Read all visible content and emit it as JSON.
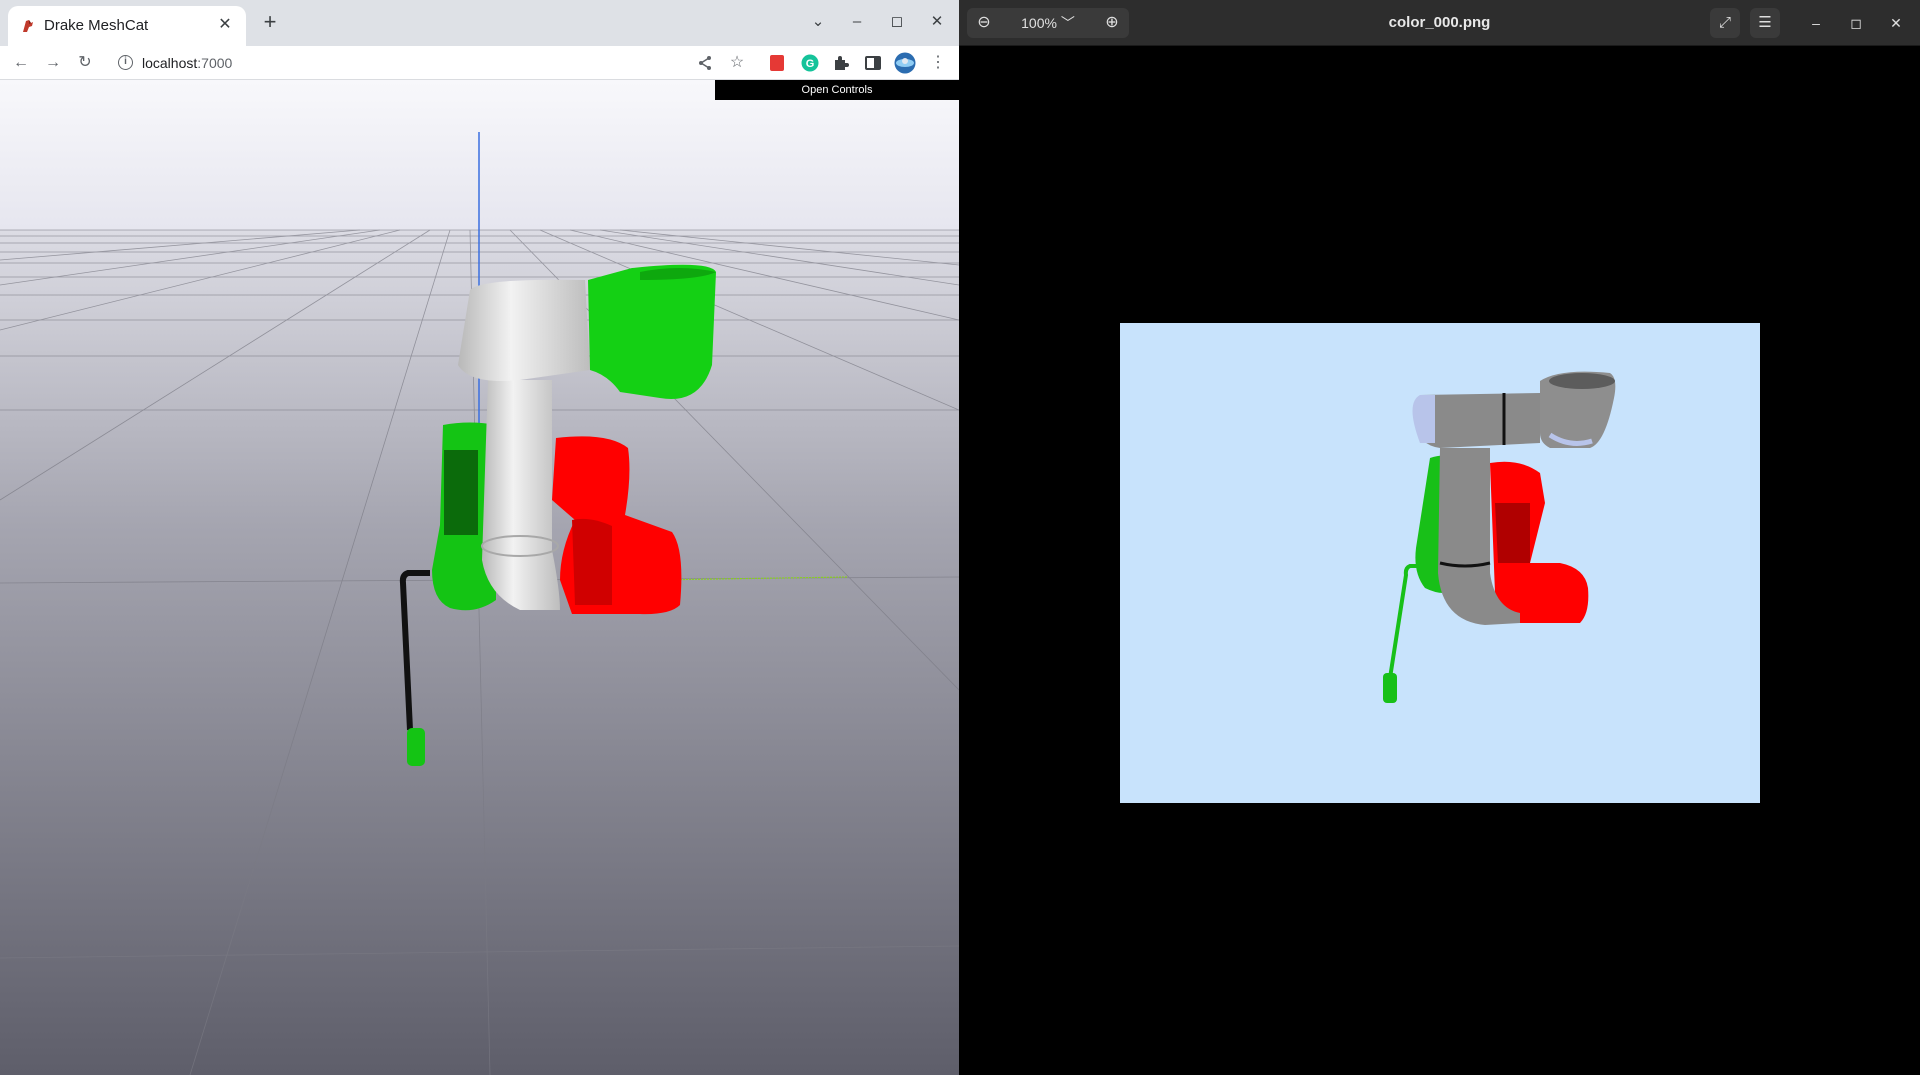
{
  "browser": {
    "tab": {
      "title": "Drake MeshCat",
      "favicon": "drake-icon"
    },
    "new_tab_icon": "plus-icon",
    "window_controls": [
      "chevron-down-icon",
      "minimize-icon",
      "maximize-icon",
      "close-icon"
    ],
    "toolbar": {
      "back_icon": "back-arrow-icon",
      "forward_icon": "forward-arrow-icon",
      "reload_icon": "reload-icon",
      "info_icon": "info-icon",
      "url_host": "localhost",
      "url_port": ":7000",
      "right_icons": [
        "share-icon",
        "star-icon",
        "extension-red-icon",
        "grammarly-icon",
        "puzzle-icon",
        "sidepanel-icon",
        "profile-avatar-icon",
        "more-vert-icon"
      ]
    },
    "meshcat": {
      "open_controls_label": "Open Controls"
    }
  },
  "viewer": {
    "zoom_out_icon": "zoom-out-icon",
    "zoom_level": "100%",
    "zoom_in_icon": "zoom-in-icon",
    "title": "color_000.png",
    "fullscreen_icon": "fullscreen-icon",
    "menu_icon": "hamburger-menu-icon",
    "window_controls": [
      "minimize-icon",
      "maximize-icon",
      "close-icon"
    ],
    "image_background": "#c8e3fc"
  },
  "colors": {
    "robot_white": "#d9d9d9",
    "robot_green": "#14d014",
    "robot_red": "#ff0000",
    "robot_gray": "#8a8a8a",
    "sky_top": "#f5f5fa",
    "ground_near": "#6b6b78"
  }
}
